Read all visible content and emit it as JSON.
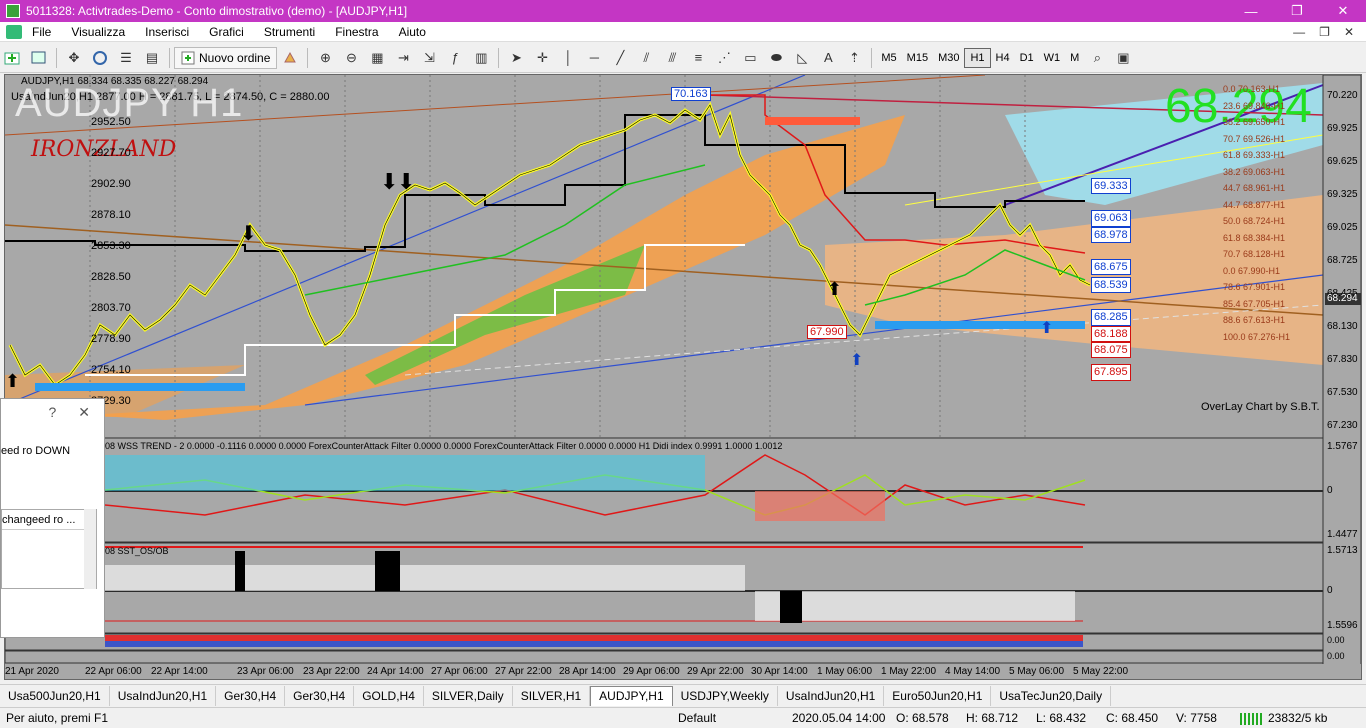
{
  "window": {
    "title": "5011328: Activtrades-Demo - Conto dimostrativo (demo) - [AUDJPY,H1]",
    "minimize_glyph": "—",
    "restore_glyph": "❐",
    "close_glyph": "✕"
  },
  "menu": {
    "items": [
      "File",
      "Visualizza",
      "Inserisci",
      "Grafici",
      "Strumenti",
      "Finestra",
      "Aiuto"
    ],
    "mdi_minimize": "—",
    "mdi_restore": "❐",
    "mdi_close": "✕"
  },
  "toolbar": {
    "new_order_label": "Nuovo ordine",
    "timeframes": [
      "M5",
      "M15",
      "M30",
      "H1",
      "H4",
      "D1",
      "W1",
      "M"
    ],
    "active_timeframe": "H1"
  },
  "chart": {
    "symbol_header": "AUDJPY,H1  68.334 68.335 68.227 68.294",
    "overlay_header": "UsaIndJun20,H1  2877.00  H = 2881.75,  L = 2874.50,  C = 2880.00",
    "watermark": "AUDJPY H1",
    "signature": "IRONZLAND",
    "big_price": "68.294",
    "current_price": "68.294",
    "overlay_caption": "OverLay Chart by S.B.T.",
    "indicator1_header": "08  WSS TREND - 2 0.0000 -0.1116 0.0000 0.0000  ForexCounterAttack Filter 0.0000 0.0000  ForexCounterAttack Filter 0.0000 0.0000  H1 Didi index 0.9991 1.0000 1.0012",
    "indicator2_header": "08  SST_OS/OB",
    "left_overlay_prices": [
      "2952.50",
      "2927.70",
      "2902.90",
      "2878.10",
      "2853.30",
      "2828.50",
      "2803.70",
      "2778.90",
      "2754.10",
      "2729.30"
    ],
    "price_axis": [
      "70.220",
      "69.925",
      "69.625",
      "69.325",
      "69.025",
      "68.725",
      "68.425",
      "68.130",
      "67.830",
      "67.530",
      "67.230"
    ],
    "ind1_axis": [
      "1.5767",
      "0",
      "1.4477"
    ],
    "ind2_axis": [
      "1.5713",
      "0",
      "1.5596"
    ],
    "ind3_axis": [
      "0.00",
      "0.00",
      "0.00"
    ],
    "time_axis": [
      "21 Apr 2020",
      "22 Apr 06:00",
      "22 Apr 14:00",
      "23 Apr 06:00",
      "23 Apr 22:00",
      "24 Apr 14:00",
      "27 Apr 06:00",
      "27 Apr 22:00",
      "28 Apr 14:00",
      "29 Apr 06:00",
      "29 Apr 22:00",
      "30 Apr 14:00",
      "1 May 06:00",
      "1 May 22:00",
      "4 May 14:00",
      "5 May 06:00",
      "5 May 22:00"
    ],
    "blue_boxes": [
      "69.333",
      "69.063",
      "68.978",
      "68.675",
      "68.539",
      "68.285"
    ],
    "red_boxes": [
      "68.188",
      "68.075",
      "67.895"
    ],
    "top_box": "70.163",
    "low_box": "67.990",
    "fib_labels": [
      "0.0  70.163-H1",
      "23.6  69.846-H1",
      "38.2  69.650-H1",
      "70.7  69.526-H1",
      "61.8  69.333-H1",
      "38.2  69.063-H1",
      "44.7  68.961-H1",
      "44.7  68.877-H1",
      "50.0  68.724-H1",
      "61.8  68.384-H1",
      "70.7  68.128-H1",
      "0.0  67.990-H1",
      "78.6  67.901-H1",
      "85.4  67.705-H1",
      "88.6  67.613-H1",
      "100.0  67.276-H1"
    ]
  },
  "dialog": {
    "help_glyph": "?",
    "close_glyph": "✕",
    "line1": "eed ro DOWN",
    "line2": "changeed ro ..."
  },
  "tabs": [
    "Usa500Jun20,H1",
    "UsaIndJun20,H1",
    "Ger30,H4",
    "Ger30,H4",
    "GOLD,H4",
    "SILVER,Daily",
    "SILVER,H1",
    "AUDJPY,H1",
    "USDJPY,Weekly",
    "UsaIndJun20,H1",
    "Euro50Jun20,H1",
    "UsaTecJun20,Daily"
  ],
  "active_tab": "AUDJPY,H1",
  "status": {
    "help": "Per aiuto, premi F1",
    "profile": "Default",
    "datetime": "2020.05.04 14:00",
    "open": "O: 68.578",
    "high": "H: 68.712",
    "low": "L: 68.432",
    "close": "C: 68.450",
    "volume": "V: 7758",
    "traffic": "23832/5 kb"
  },
  "colors": {
    "chart_bg": "#a6a6a6",
    "title_bar": "#c436c4",
    "big_price": "#22e022",
    "candle": "#ffff22",
    "orange_zone": "#f5a04a",
    "green_zone": "#6fbf45",
    "cyan_zone": "#9fe0ee"
  }
}
